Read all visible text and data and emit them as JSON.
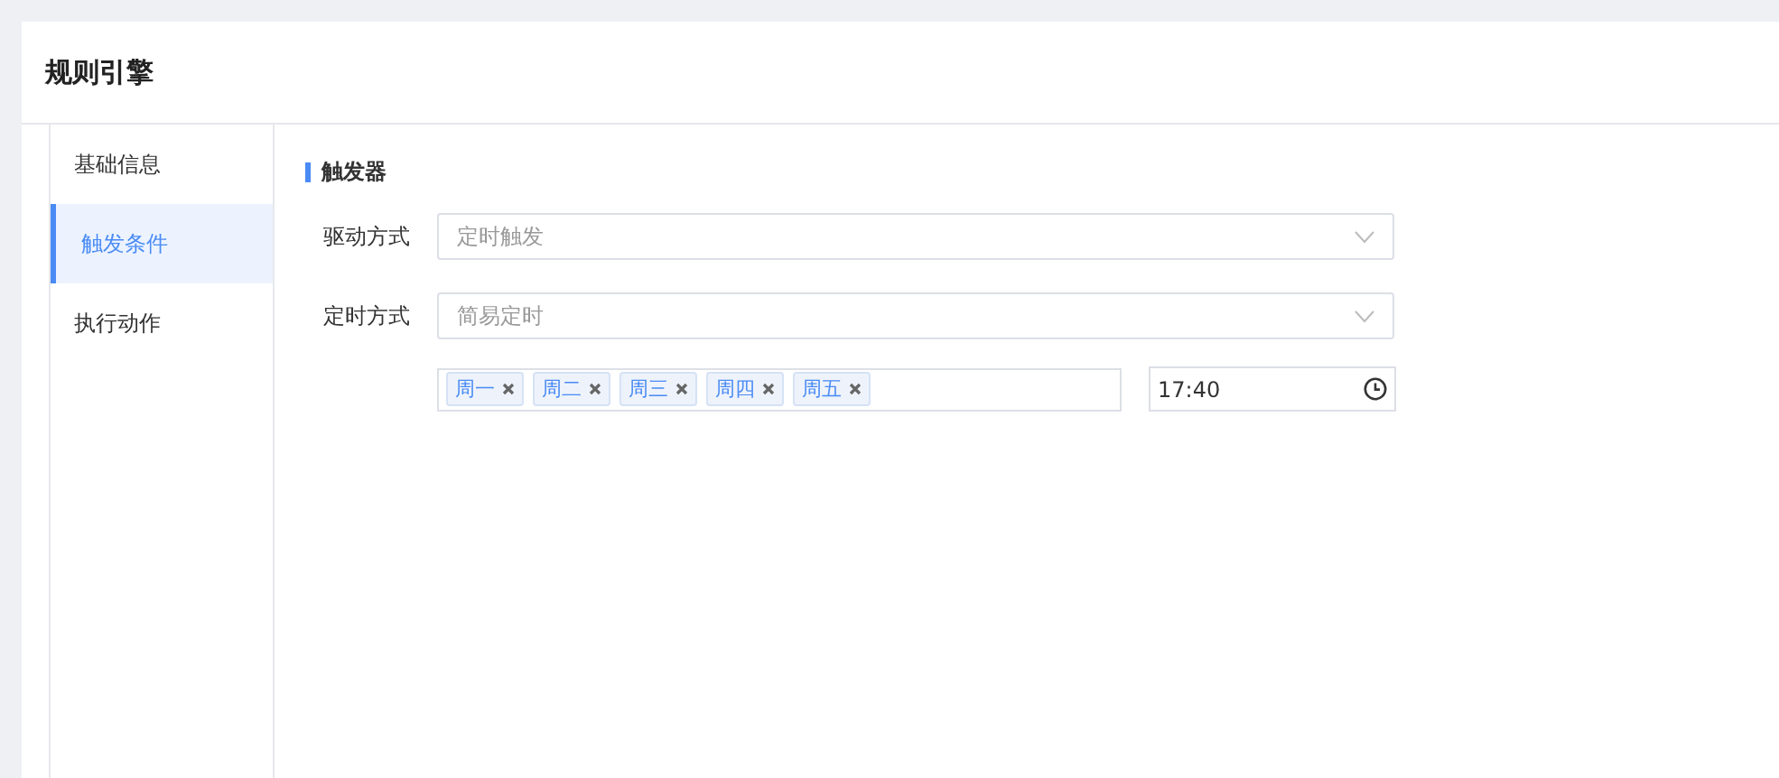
{
  "page": {
    "title": "规则引擎"
  },
  "sidebar": {
    "items": [
      {
        "label": "基础信息",
        "selected": false
      },
      {
        "label": "触发条件",
        "selected": true
      },
      {
        "label": "执行动作",
        "selected": false
      }
    ]
  },
  "section": {
    "title": "触发器"
  },
  "form": {
    "fields": [
      {
        "label": "驱动方式",
        "value": "定时触发"
      },
      {
        "label": "定时方式",
        "value": "简易定时"
      }
    ],
    "days": [
      "周一",
      "周二",
      "周三",
      "周四",
      "周五"
    ],
    "time": "17:40"
  }
}
